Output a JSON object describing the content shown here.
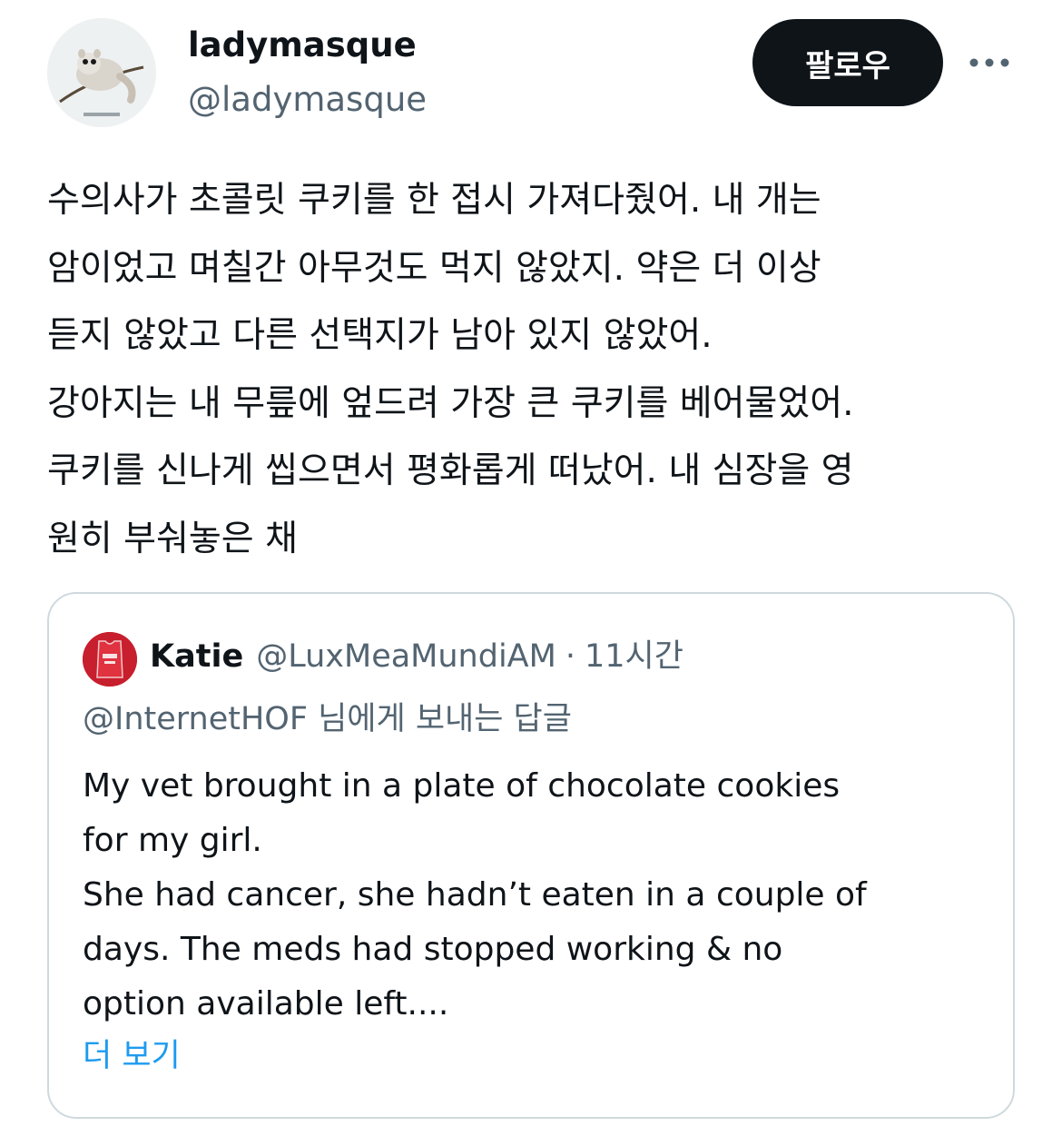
{
  "author": {
    "display_name": "ladymasque",
    "handle": "@ladymasque",
    "avatar_icon": "avatar-flying-squirrel-illustration"
  },
  "actions": {
    "follow_label": "팔로우",
    "more_icon": "more-horizontal-icon"
  },
  "tweet": {
    "text": "수의사가 초콜릿 쿠키를 한 접시 가져다줬어. 내 개는\n암이었고 며칠간 아무것도 먹지 않았지. 약은 더 이상\n듣지 않았고 다른 선택지가 남아 있지 않았어.\n강아지는 내 무릎에 엎드려 가장 큰 쿠키를 베어물었어.\n쿠키를 신나게 씹으면서 평화롭게 떠났어. 내 심장을 영\n원히 부숴놓은 채"
  },
  "quoted": {
    "name": "Katie",
    "handle": "@LuxMeaMundiAM",
    "separator": "·",
    "time": "11시간",
    "reply_to": "@InternetHOF 님에게 보내는 답글",
    "text": "My vet brought in a plate of chocolate cookies\nfor my girl.\nShe had cancer, she hadn’t eaten in a couple of\ndays. The meds had stopped working & no\noption available left....",
    "show_more": "더 보기",
    "avatar_icon": "avatar-red-jersey"
  },
  "colors": {
    "text_primary": "#0f1419",
    "text_secondary": "#536471",
    "link": "#1d9bf0",
    "button_bg": "#0f1419",
    "border": "#cfd9de"
  }
}
